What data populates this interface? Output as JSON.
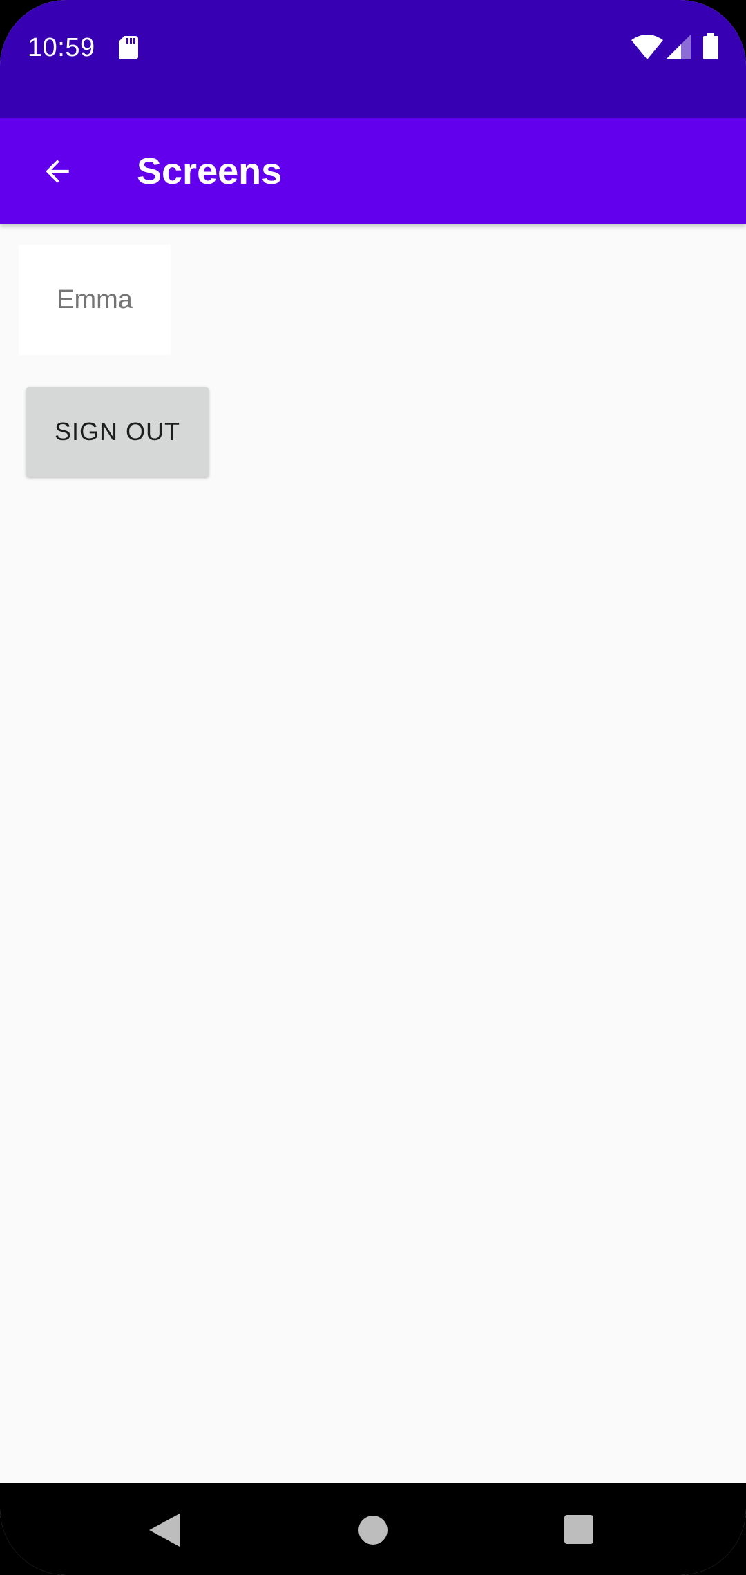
{
  "status_bar": {
    "time": "10:59",
    "icons": [
      "sd-card-icon",
      "wifi-icon",
      "cellular-signal-icon",
      "battery-icon"
    ]
  },
  "app_bar": {
    "title": "Screens",
    "back_icon": "arrow-back-icon",
    "background_color": "#6200ee",
    "status_color": "#3700b3"
  },
  "main": {
    "name_field": {
      "value": "",
      "placeholder": "Emma"
    },
    "sign_out_label": "SIGN OUT"
  },
  "nav_bar": {
    "icons": [
      "nav-back-icon",
      "nav-home-icon",
      "nav-recents-icon"
    ]
  }
}
